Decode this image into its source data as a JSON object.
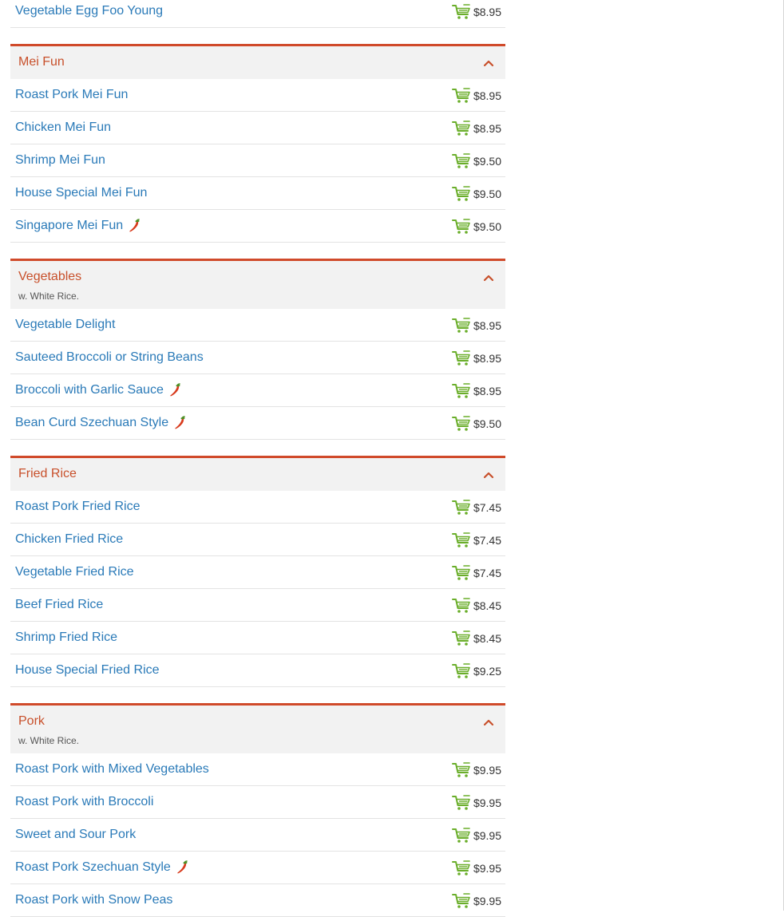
{
  "leading_items": [
    {
      "name": "Vegetable Egg Foo Young",
      "price": "$8.95",
      "spicy": false
    }
  ],
  "categories": [
    {
      "title": "Mei Fun",
      "note": "",
      "items": [
        {
          "name": "Roast Pork Mei Fun",
          "price": "$8.95",
          "spicy": false
        },
        {
          "name": "Chicken Mei Fun",
          "price": "$8.95",
          "spicy": false
        },
        {
          "name": "Shrimp Mei Fun",
          "price": "$9.50",
          "spicy": false
        },
        {
          "name": "House Special Mei Fun",
          "price": "$9.50",
          "spicy": false
        },
        {
          "name": "Singapore Mei Fun",
          "price": "$9.50",
          "spicy": true
        }
      ]
    },
    {
      "title": "Vegetables",
      "note": "w. White Rice.",
      "items": [
        {
          "name": "Vegetable Delight",
          "price": "$8.95",
          "spicy": false
        },
        {
          "name": "Sauteed Broccoli or String Beans",
          "price": "$8.95",
          "spicy": false
        },
        {
          "name": "Broccoli with Garlic Sauce",
          "price": "$8.95",
          "spicy": true
        },
        {
          "name": "Bean Curd Szechuan Style",
          "price": "$9.50",
          "spicy": true
        }
      ]
    },
    {
      "title": "Fried Rice",
      "note": "",
      "items": [
        {
          "name": "Roast Pork Fried Rice",
          "price": "$7.45",
          "spicy": false
        },
        {
          "name": "Chicken Fried Rice",
          "price": "$7.45",
          "spicy": false
        },
        {
          "name": "Vegetable Fried Rice",
          "price": "$7.45",
          "spicy": false
        },
        {
          "name": "Beef Fried Rice",
          "price": "$8.45",
          "spicy": false
        },
        {
          "name": "Shrimp Fried Rice",
          "price": "$8.45",
          "spicy": false
        },
        {
          "name": "House Special Fried Rice",
          "price": "$9.25",
          "spicy": false
        }
      ]
    },
    {
      "title": "Pork",
      "note": "w. White Rice.",
      "items": [
        {
          "name": "Roast Pork with Mixed Vegetables",
          "price": "$9.95",
          "spicy": false
        },
        {
          "name": "Roast Pork with Broccoli",
          "price": "$9.95",
          "spicy": false
        },
        {
          "name": "Sweet and Sour Pork",
          "price": "$9.95",
          "spicy": false
        },
        {
          "name": "Roast Pork Szechuan Style",
          "price": "$9.95",
          "spicy": true
        },
        {
          "name": "Roast Pork with Snow Peas",
          "price": "$9.95",
          "spicy": false
        }
      ]
    }
  ],
  "icons": {
    "cart": "shopping-cart-icon",
    "spicy": "chili-pepper-icon",
    "collapse": "chevron-up-icon"
  },
  "colors": {
    "item_link": "#2a7ab8",
    "category_title": "#c8502b",
    "category_border": "#d04a2a",
    "cart": "#6aae2a",
    "pepper": "#d83a1c"
  }
}
